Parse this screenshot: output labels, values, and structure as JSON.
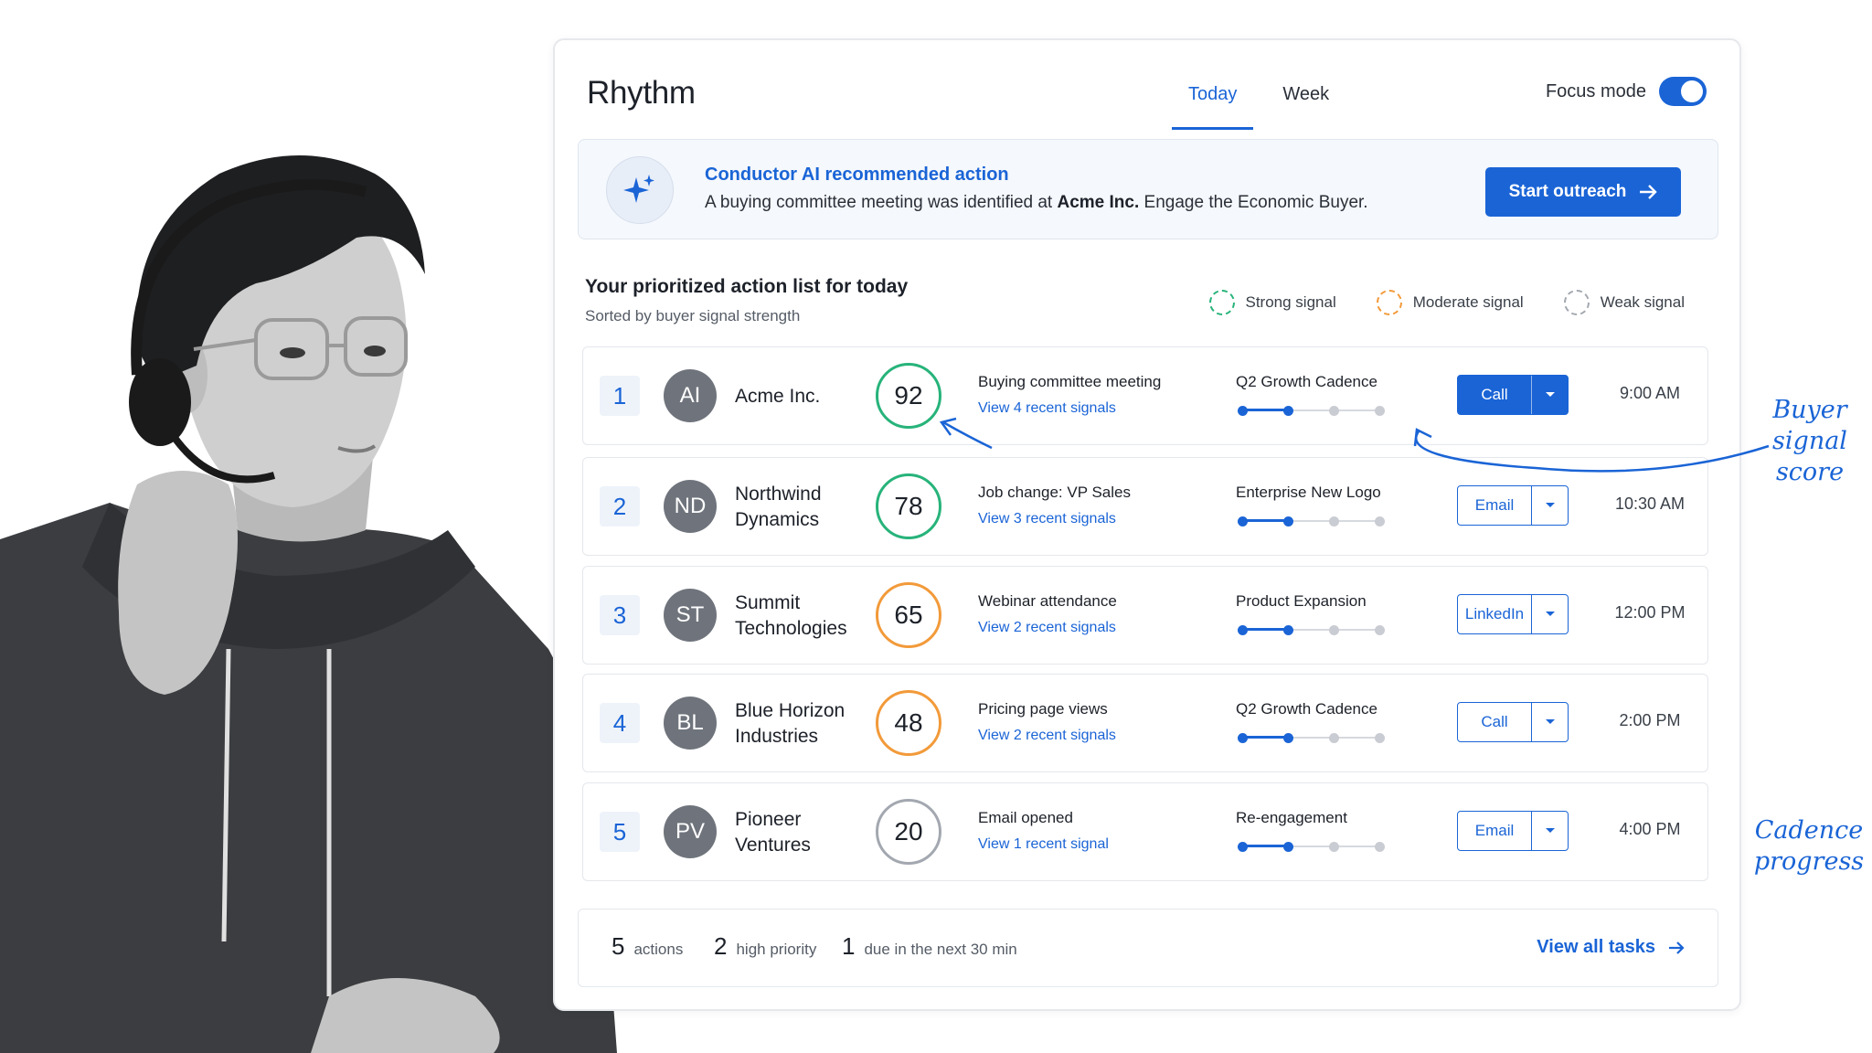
{
  "app": {
    "title": "Rhythm",
    "tabs": [
      {
        "label": "Today",
        "active": true
      },
      {
        "label": "Week",
        "active": false
      }
    ],
    "focus_mode": {
      "label": "Focus mode",
      "on": true
    }
  },
  "banner": {
    "icon": "sparkle-icon",
    "title": "Conductor AI recommended action",
    "text_before": "A buying committee meeting was identified at ",
    "text_bold": "Acme Inc.",
    "text_after": " Engage the Economic Buyer.",
    "button_label": "Start outreach"
  },
  "list": {
    "title": "Your prioritized action list for today",
    "subtitle": "Sorted by buyer signal strength",
    "legend": [
      {
        "label": "Strong signal",
        "color": "#27b37a"
      },
      {
        "label": "Moderate signal",
        "color": "#f29a3a"
      },
      {
        "label": "Weak signal",
        "color": "#a3a8b0"
      }
    ],
    "rows": [
      {
        "rank": "1",
        "initials": "AI",
        "company": "Acme Inc.",
        "score": "92",
        "strength": "strong",
        "signal": "Buying committee meeting",
        "signal_link": "View 4 recent signals",
        "cadence": "Q2 Growth Cadence",
        "cadence_step": 2,
        "cadence_steps": 4,
        "action": "Call",
        "primary": true,
        "time": "9:00 AM"
      },
      {
        "rank": "2",
        "initials": "ND",
        "company": "Northwind Dynamics",
        "score": "78",
        "strength": "strong",
        "signal": "Job change: VP Sales",
        "signal_link": "View 3 recent signals",
        "cadence": "Enterprise New Logo",
        "cadence_step": 2,
        "cadence_steps": 4,
        "action": "Email",
        "primary": false,
        "time": "10:30 AM"
      },
      {
        "rank": "3",
        "initials": "ST",
        "company": "Summit Technologies",
        "score": "65",
        "strength": "moderate",
        "signal": "Webinar attendance",
        "signal_link": "View 2 recent signals",
        "cadence": "Product Expansion",
        "cadence_step": 2,
        "cadence_steps": 4,
        "action": "LinkedIn",
        "primary": false,
        "time": "12:00 PM"
      },
      {
        "rank": "4",
        "initials": "BL",
        "company": "Blue Horizon Industries",
        "score": "48",
        "strength": "moderate",
        "signal": "Pricing page views",
        "signal_link": "View 2 recent signals",
        "cadence": "Q2 Growth Cadence",
        "cadence_step": 2,
        "cadence_steps": 4,
        "action": "Call",
        "primary": false,
        "time": "2:00 PM"
      },
      {
        "rank": "5",
        "initials": "PV",
        "company": "Pioneer Ventures",
        "score": "20",
        "strength": "weak",
        "signal": "Email opened",
        "signal_link": "View 1 recent signal",
        "cadence": "Re-engagement",
        "cadence_step": 2,
        "cadence_steps": 4,
        "action": "Email",
        "primary": false,
        "time": "4:00 PM"
      }
    ]
  },
  "footer": {
    "stats": [
      {
        "num": "5",
        "label": "actions"
      },
      {
        "num": "2",
        "label": "high priority"
      },
      {
        "num": "1",
        "label": "due in the next 30 min"
      }
    ],
    "view_all": "View all tasks"
  },
  "annotations": {
    "buyer_signal_score": [
      "Buyer",
      "signal",
      "score"
    ],
    "cadence_progress": [
      "Cadence",
      "progress"
    ]
  },
  "colors": {
    "accent": "#1a64d6",
    "strong": "#27b37a",
    "moderate": "#f29a3a",
    "weak": "#a3a8b0"
  }
}
